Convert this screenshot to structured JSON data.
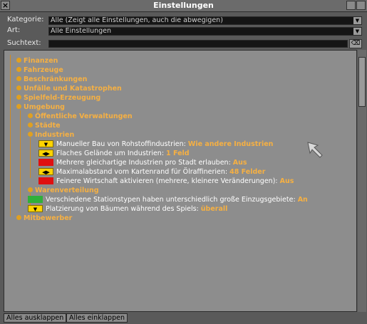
{
  "window": {
    "title": "Einstellungen"
  },
  "filters": {
    "kategorie_label": "Kategorie:",
    "kategorie_value": "Alle (Zeigt alle Einstellungen, auch die abwegigen)",
    "art_label": "Art:",
    "art_value": "Alle Einstellungen",
    "suchtext_label": "Suchtext:",
    "suchtext_value": ""
  },
  "tree": {
    "finanzen": "Finanzen",
    "fahrzeuge": "Fahrzeuge",
    "beschraenkungen": "Beschränkungen",
    "unfaelle": "Unfälle und Katastrophen",
    "spielfeld": "Spielfeld-Erzeugung",
    "umgebung": "Umgebung",
    "verwaltungen": "Öffentliche Verwaltungen",
    "staedte": "Städte",
    "industrien": "Industrien",
    "industrie_settings": [
      {
        "label": "Manueller Bau von Rohstoffindustrien: ",
        "value": "Wie andere Industrien",
        "control": "dropdown"
      },
      {
        "label": "Flaches Gelände um Industrien: ",
        "value": "1 Feld",
        "control": "stepper"
      },
      {
        "label": "Mehrere gleichartige Industrien pro Stadt erlauben: ",
        "value": "Aus",
        "control": "toggle-off"
      },
      {
        "label": "Maximalabstand vom Kartenrand für Ölraffinerien: ",
        "value": "48 Felder",
        "control": "stepper"
      },
      {
        "label": "Feinere Wirtschaft aktivieren (mehrere, kleinere Veränderungen): ",
        "value": "Aus",
        "control": "toggle-off"
      }
    ],
    "warenverteilung": "Warenverteilung",
    "umgebung_settings": [
      {
        "label": "Verschiedene Stationstypen haben unterschiedlich große Einzugsgebiete: ",
        "value": "An",
        "control": "toggle-on"
      },
      {
        "label": "Platzierung von Bäumen während des Spiels: ",
        "value": "überall",
        "control": "dropdown"
      }
    ],
    "mitbewerber": "Mitbewerber"
  },
  "buttons": {
    "expand_all": "Alles ausklappen",
    "collapse_all": "Alles einklappen"
  },
  "colors": {
    "label_orange": "#f6b042",
    "toggle_off": "#e01010",
    "toggle_on": "#2fb03a",
    "button_yellow": "#ffd400"
  }
}
